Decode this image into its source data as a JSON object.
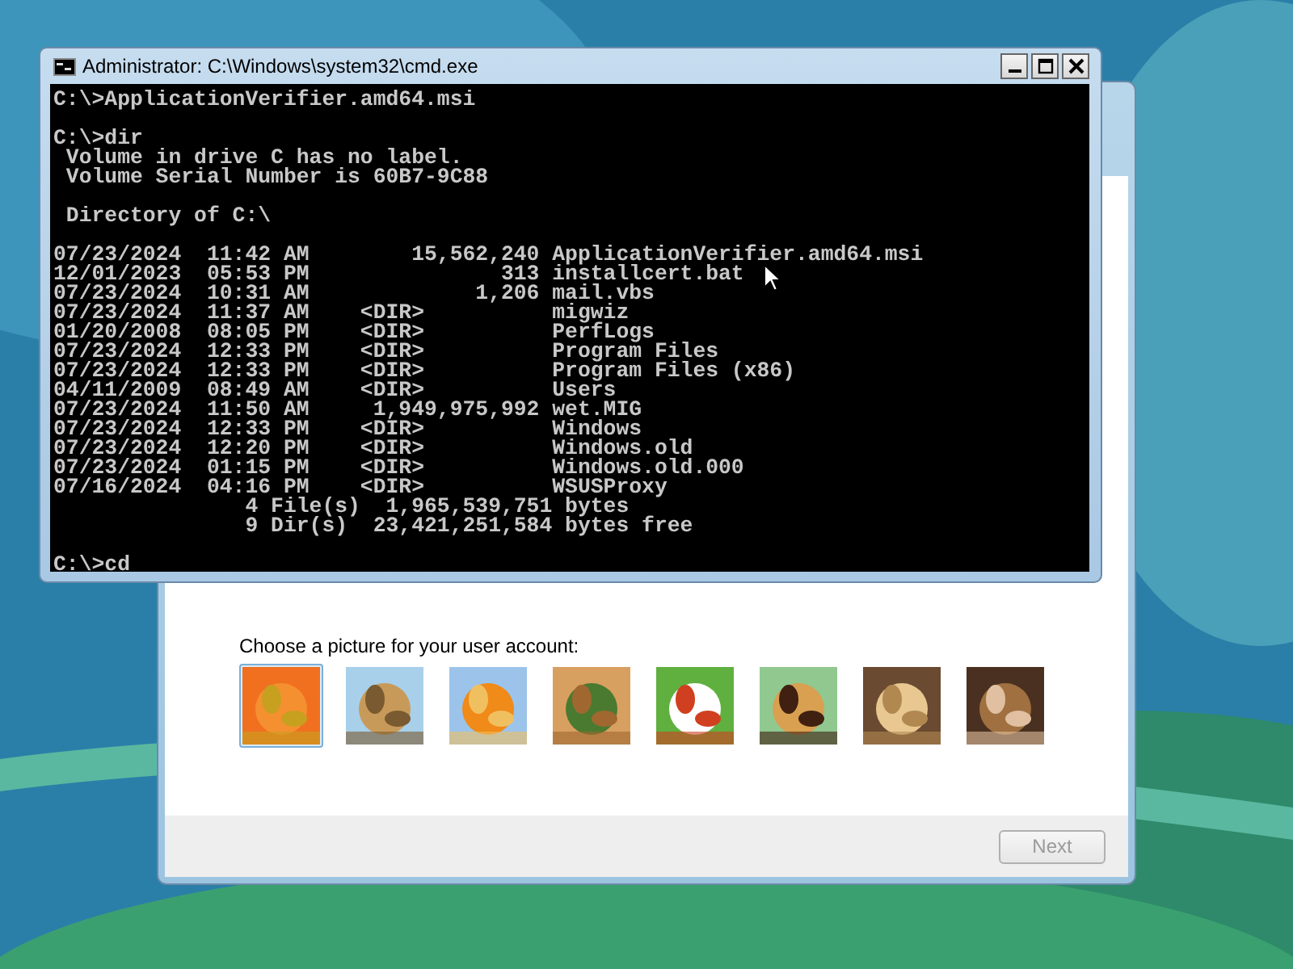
{
  "setup_dialog": {
    "prompt": "Choose a picture for your user account:",
    "pictures": [
      {
        "kind": "picture",
        "selected": true
      },
      {
        "kind": "picture",
        "selected": false
      },
      {
        "kind": "picture",
        "selected": false
      },
      {
        "kind": "picture",
        "selected": false
      },
      {
        "kind": "picture",
        "selected": false
      },
      {
        "kind": "picture",
        "selected": false
      },
      {
        "kind": "picture",
        "selected": false
      },
      {
        "kind": "picture",
        "selected": false
      }
    ],
    "next_button": {
      "label": "Next",
      "disabled": true
    }
  },
  "console_window": {
    "title": "Administrator: C:\\Windows\\system32\\cmd.exe",
    "lines": [
      {
        "kind": "text",
        "text": "C:\\>ApplicationVerifier.amd64.msi"
      },
      {
        "kind": "blank"
      },
      {
        "kind": "text",
        "text": "C:\\>dir"
      },
      {
        "kind": "text",
        "text": " Volume in drive C has no label."
      },
      {
        "kind": "text",
        "text": " Volume Serial Number is 60B7-9C88"
      },
      {
        "kind": "blank"
      },
      {
        "kind": "text",
        "text": " Directory of C:\\"
      },
      {
        "kind": "blank"
      },
      {
        "kind": "text",
        "text": "07/23/2024  11:42 AM        15,562,240 ApplicationVerifier.amd64.msi"
      },
      {
        "kind": "text",
        "text": "12/01/2023  05:53 PM               313 installcert.bat"
      },
      {
        "kind": "text",
        "text": "07/23/2024  10:31 AM             1,206 mail.vbs"
      },
      {
        "kind": "text",
        "text": "07/23/2024  11:37 AM    <DIR>          migwiz"
      },
      {
        "kind": "text",
        "text": "01/20/2008  08:05 PM    <DIR>          PerfLogs"
      },
      {
        "kind": "text",
        "text": "07/23/2024  12:33 PM    <DIR>          Program Files"
      },
      {
        "kind": "text",
        "text": "07/23/2024  12:33 PM    <DIR>          Program Files (x86)"
      },
      {
        "kind": "text",
        "text": "04/11/2009  08:49 AM    <DIR>          Users"
      },
      {
        "kind": "text",
        "text": "07/23/2024  11:50 AM     1,949,975,992 wet.MIG"
      },
      {
        "kind": "text",
        "text": "07/23/2024  12:33 PM    <DIR>          Windows"
      },
      {
        "kind": "text",
        "text": "07/23/2024  12:20 PM    <DIR>          Windows.old"
      },
      {
        "kind": "text",
        "text": "07/23/2024  01:15 PM    <DIR>          Windows.old.000"
      },
      {
        "kind": "text",
        "text": "07/16/2024  04:16 PM    <DIR>          WSUSProxy"
      },
      {
        "kind": "text",
        "text": "               4 File(s)  1,965,539,751 bytes"
      },
      {
        "kind": "text",
        "text": "               9 Dir(s)  23,421,251,584 bytes free"
      },
      {
        "kind": "blank"
      },
      {
        "kind": "text",
        "text": "C:\\>cd"
      }
    ]
  }
}
